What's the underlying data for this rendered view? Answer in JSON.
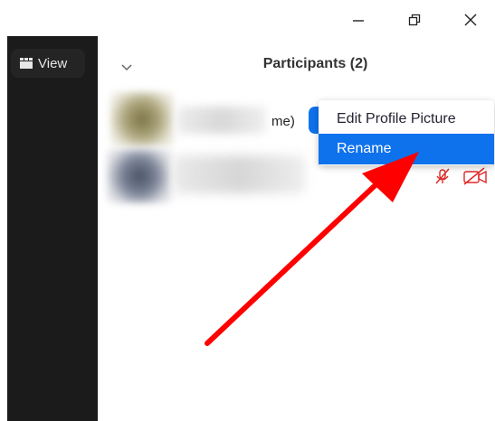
{
  "window_controls": {
    "minimize_icon": "minimize-icon",
    "restore_icon": "restore-icon",
    "close_icon": "close-icon"
  },
  "sidebar": {
    "view_label": "View",
    "view_icon": "grid-view-icon"
  },
  "participants": {
    "title": "Participants (2)",
    "rows": [
      {
        "name_suffix": "me)",
        "name_blurred": true
      },
      {
        "name_blurred": true,
        "mic": "muted",
        "video": "off"
      }
    ]
  },
  "context_menu": {
    "items": [
      {
        "label": "Edit Profile Picture",
        "highlighted": false
      },
      {
        "label": "Rename",
        "highlighted": true
      }
    ]
  },
  "colors": {
    "accent_blue": "#0e72ed",
    "muted_red": "#e02828",
    "annotation_arrow": "#ff0000"
  }
}
